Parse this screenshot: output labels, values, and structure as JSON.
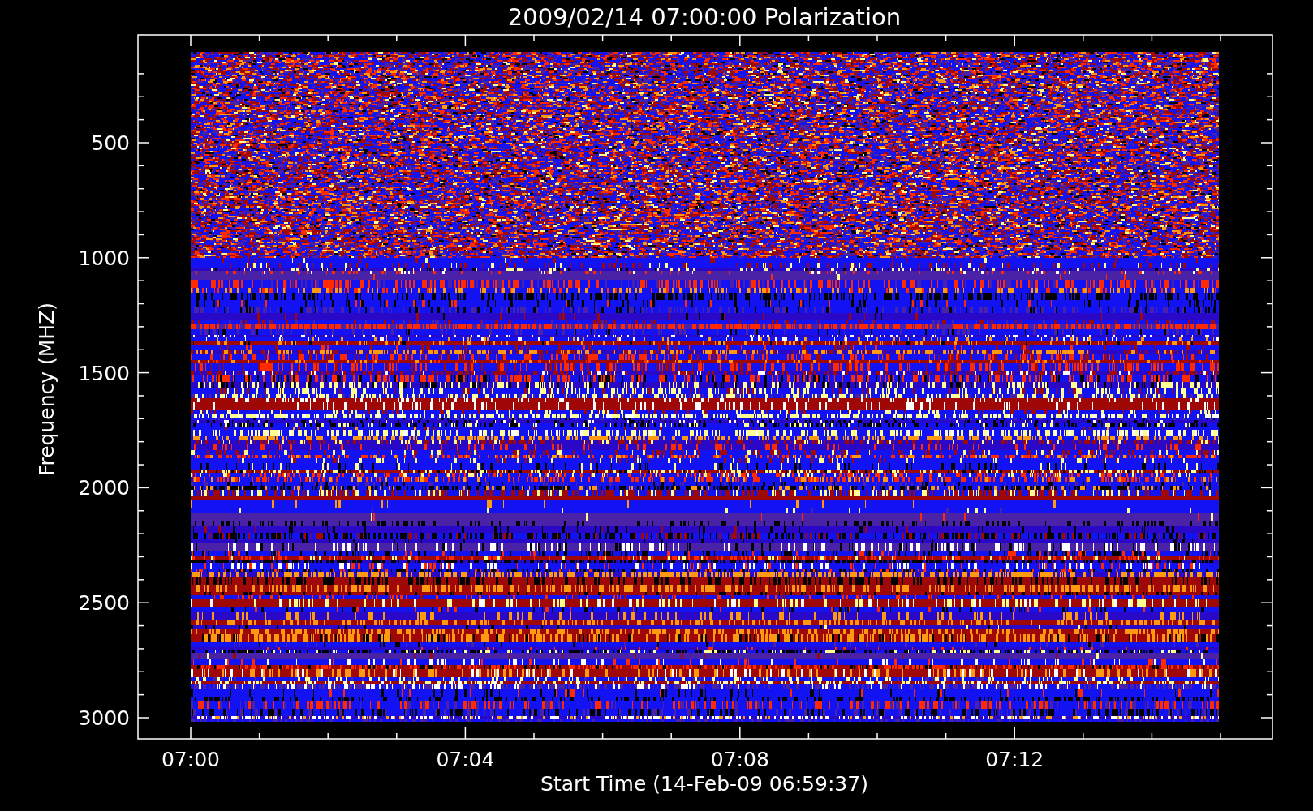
{
  "title": "2009/02/14 07:00:00 Polarization",
  "y_axis": {
    "label": "Frequency (MHZ)",
    "ticks": [
      "500",
      "1000",
      "1500",
      "2000",
      "2500",
      "3000"
    ]
  },
  "x_axis": {
    "label": "Start Time (14-Feb-09 06:59:37)",
    "ticks": [
      "07:00",
      "07:04",
      "07:08",
      "07:12"
    ]
  }
}
